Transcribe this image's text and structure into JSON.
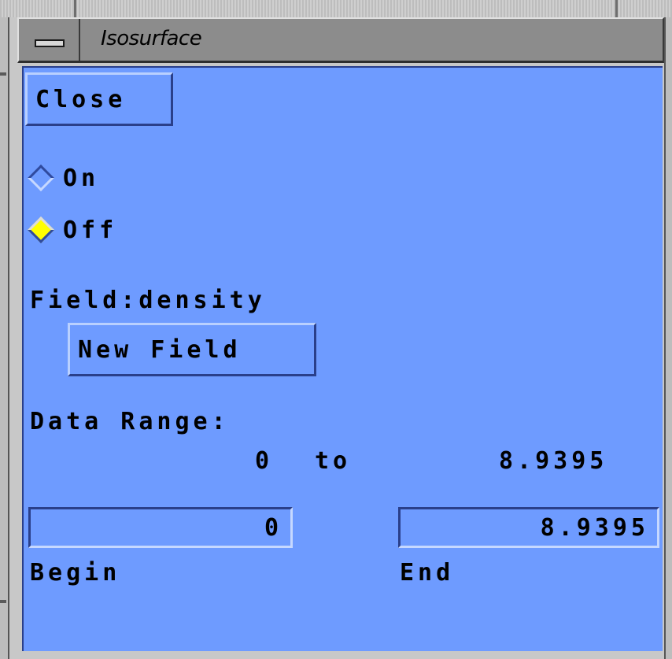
{
  "window": {
    "title": "Isosurface"
  },
  "buttons": {
    "close": "Close",
    "new_field": "New Field"
  },
  "toggle": {
    "on_label": "On",
    "off_label": "Off",
    "selected": "Off"
  },
  "field": {
    "label": "Field:",
    "value": "density"
  },
  "data_range": {
    "label": "Data Range:",
    "min": "0",
    "to": "to",
    "max": "8.9395"
  },
  "inputs": {
    "begin_value": "0",
    "end_value": "8.9395",
    "begin_label": "Begin",
    "end_label": "End"
  },
  "colors": {
    "panel": "#6e9bff",
    "selected_radio": "#ffff00",
    "titlebar": "#8c8c8c"
  },
  "icons": {
    "window_menu": "window-menu-icon",
    "radio": "diamond-radio-icon"
  }
}
